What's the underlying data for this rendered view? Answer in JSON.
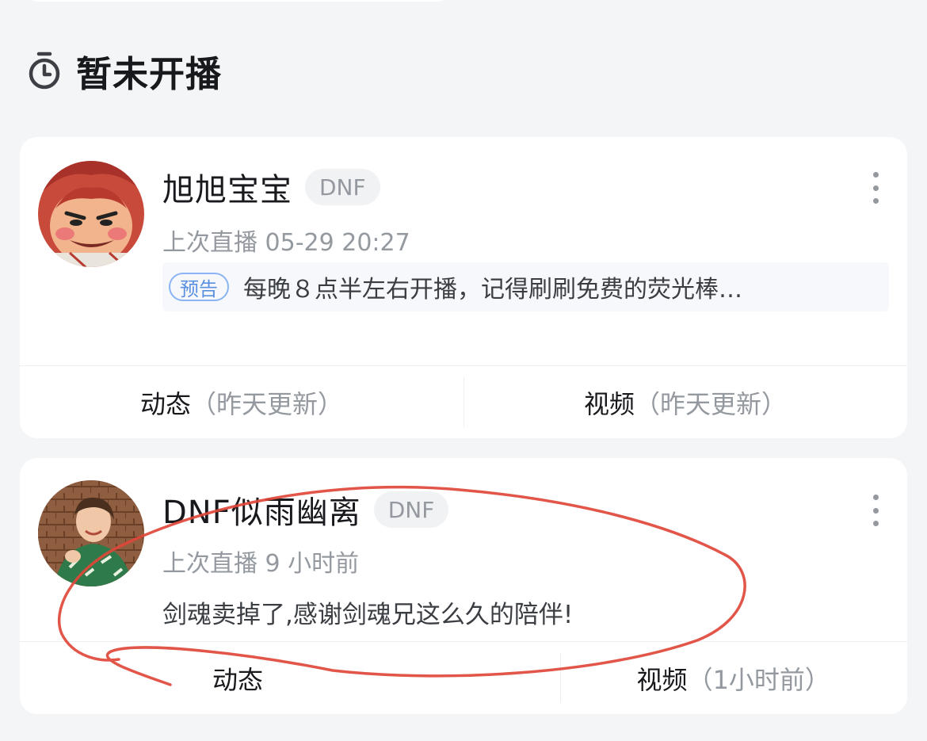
{
  "section": {
    "title": "暂未开播",
    "icon": "timer-icon"
  },
  "cards": [
    {
      "name": "旭旭宝宝",
      "tag": "DNF",
      "last_live": "上次直播 05-29 20:27",
      "notice_badge": "预告",
      "notice_text": "每晚８点半左右开播，记得刷刷免费的荧光棒…",
      "footer": [
        {
          "label": "动态",
          "note": "（昨天更新）"
        },
        {
          "label": "视频",
          "note": "（昨天更新）"
        }
      ]
    },
    {
      "name": "DNF似雨幽离",
      "tag": "DNF",
      "last_live": "上次直播 9 小时前",
      "post_text": "剑魂卖掉了,感谢剑魂兄这么久的陪伴!",
      "footer": [
        {
          "label": "动态",
          "note": ""
        },
        {
          "label": "视频",
          "note": "（1小时前）"
        }
      ]
    }
  ],
  "colors": {
    "background": "#f4f5f7",
    "card": "#ffffff",
    "tag_bg": "#f1f2f3",
    "muted_text": "#9499a0",
    "notice_border": "#8ab4f3",
    "annotation_red": "#e0473a"
  }
}
